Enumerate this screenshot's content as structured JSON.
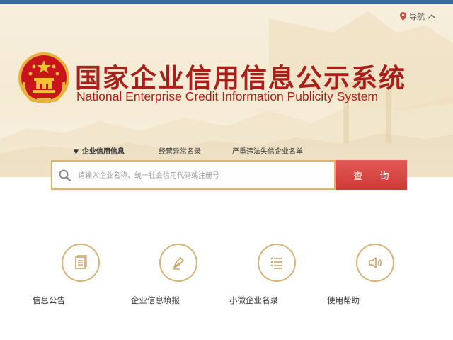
{
  "header": {
    "nav_label": "导航"
  },
  "logo": {
    "title_cn": "国家企业信用信息公示系统",
    "title_en": "National Enterprise Credit Information Publicity System"
  },
  "tabs": [
    {
      "label": "企业信用信息",
      "active": true
    },
    {
      "label": "经营异常名录",
      "active": false
    },
    {
      "label": "严重违法失信企业名单",
      "active": false
    }
  ],
  "search": {
    "placeholder": "请输入企业名称、统一社会信用代码或注册号",
    "value": "",
    "button_label": "查 询"
  },
  "features": [
    {
      "label": "信息公告",
      "icon": "document-icon"
    },
    {
      "label": "企业信息填报",
      "icon": "pen-icon"
    },
    {
      "label": "小微企业名录",
      "icon": "list-icon"
    },
    {
      "label": "使用帮助",
      "icon": "speaker-icon"
    }
  ],
  "colors": {
    "brand_red": "#a8201a",
    "button_red": "#d9453f",
    "gold": "#d6b37a",
    "top_bar": "#3a6a95"
  }
}
